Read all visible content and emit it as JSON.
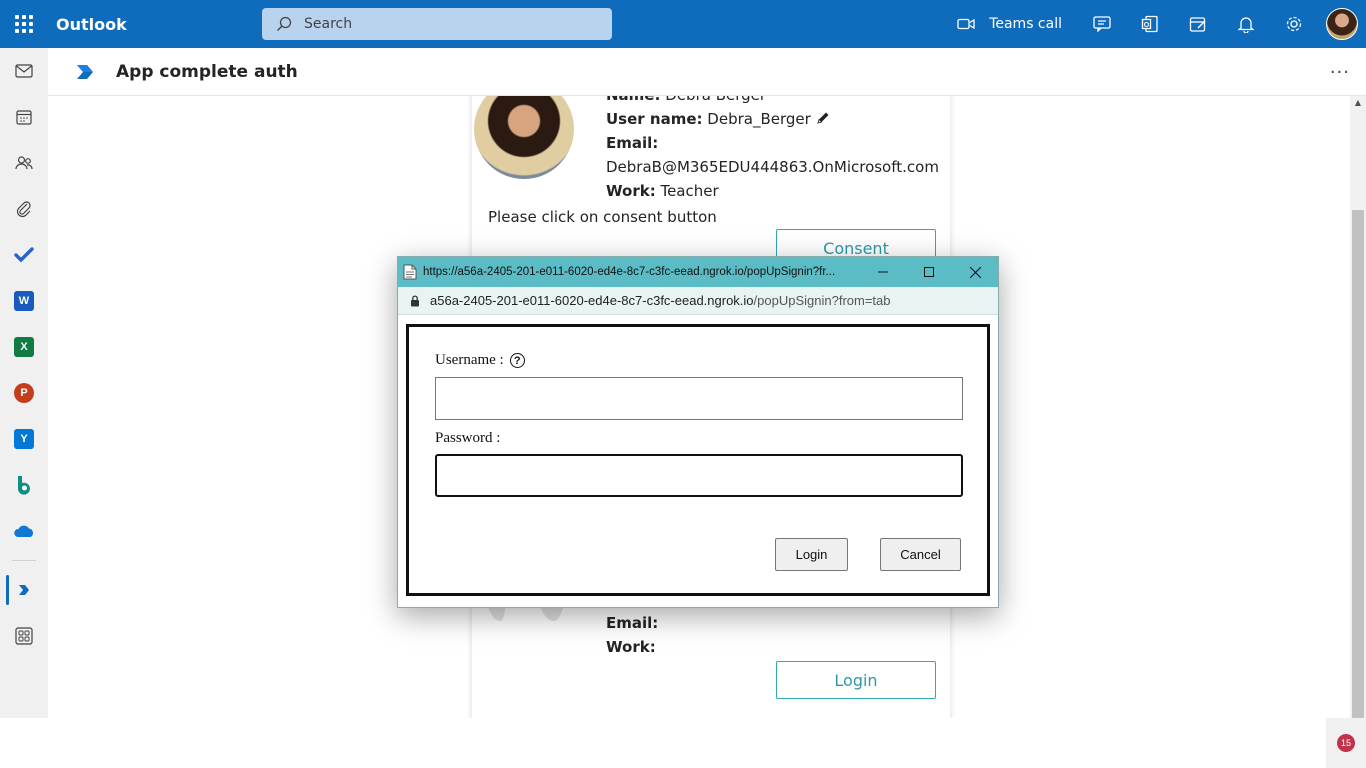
{
  "topbar": {
    "app_name": "Outlook",
    "search_placeholder": "Search",
    "teams_call_label": "Teams call",
    "icons": [
      "app-launcher-icon",
      "video-camera-icon",
      "chat-icon",
      "office-icon",
      "my-day-icon",
      "bell-icon",
      "gear-icon"
    ]
  },
  "rail": {
    "items": [
      "mail",
      "calendar",
      "people",
      "attachments",
      "to-do",
      "word",
      "excel",
      "powerpoint",
      "yammer",
      "bookings",
      "onedrive",
      "app-complete-auth",
      "more-apps"
    ],
    "tiles": {
      "word": "W",
      "excel": "X",
      "powerpoint": "P",
      "yammer": "Y"
    },
    "colors": {
      "word": "#185abd",
      "excel": "#107c41",
      "powerpoint": "#c43e1c",
      "yammer": "#0078d4",
      "todo": "#2564cf",
      "onedrive": "#0f78d4"
    }
  },
  "header": {
    "title": "App complete auth",
    "more_label": "···"
  },
  "card": {
    "name_label": "Name:",
    "name_value": "Debra Berger",
    "username_label": "User name:",
    "username_value": "Debra_Berger",
    "email_label": "Email:",
    "email_value": "DebraB@M365EDU444863.OnMicrosoft.com",
    "work_label": "Work:",
    "work_value": "Teacher",
    "note": "Please click on consent button",
    "consent_button": "Consent",
    "email_label_2": "Email:",
    "work_label_2": "Work:",
    "login_button": "Login"
  },
  "popup": {
    "title_url": "https://a56a-2405-201-e011-6020-ed4e-8c7-c3fc-eead.ngrok.io/popUpSignin?fr...",
    "address_host": "a56a-2405-201-e011-6020-ed4e-8c7-c3fc-eead.ngrok.io",
    "address_path": "/popUpSignin?from=tab",
    "username_label": "Username :",
    "help_glyph": "?",
    "password_label": "Password :",
    "username_value": "",
    "password_value": "",
    "login_button": "Login",
    "cancel_button": "Cancel",
    "title_bar_color": "#5bbcc5"
  },
  "notifications": {
    "badge_count": "15"
  }
}
